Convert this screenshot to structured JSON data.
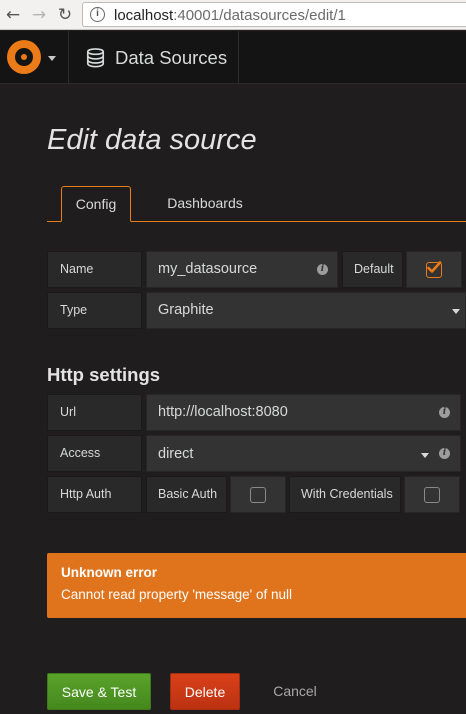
{
  "browser": {
    "url_host": "localhost",
    "url_rest": ":40001/datasources/edit/1"
  },
  "navbar": {
    "breadcrumb_label": "Data Sources"
  },
  "page": {
    "title": "Edit data source"
  },
  "tabs": [
    {
      "label": "Config",
      "active": true
    },
    {
      "label": "Dashboards",
      "active": false
    }
  ],
  "form": {
    "name_label": "Name",
    "name_value": "my_datasource",
    "default_label": "Default",
    "default_checked": true,
    "type_label": "Type",
    "type_value": "Graphite"
  },
  "http": {
    "section_title": "Http settings",
    "url_label": "Url",
    "url_value": "http://localhost:8080",
    "access_label": "Access",
    "access_value": "direct",
    "auth_label": "Http Auth",
    "basic_auth_label": "Basic Auth",
    "basic_auth_checked": false,
    "with_credentials_label": "With Credentials",
    "with_credentials_checked": false
  },
  "alert": {
    "title": "Unknown error",
    "message": "Cannot read property 'message' of null"
  },
  "buttons": {
    "save_test": "Save & Test",
    "delete": "Delete",
    "cancel": "Cancel"
  },
  "colors": {
    "accent": "#eb7b18",
    "alert_bg": "#e0741d",
    "save_button": "#4f9626",
    "delete_button": "#ca3815"
  }
}
